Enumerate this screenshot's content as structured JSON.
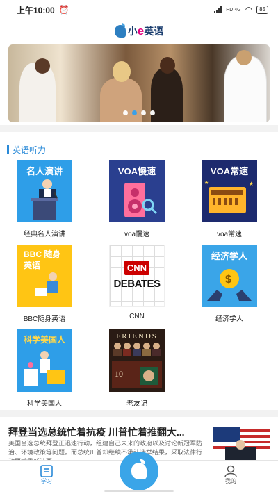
{
  "status_bar": {
    "time": "上午10:00",
    "network_label": "HD 4G",
    "battery": "85"
  },
  "header": {
    "logo_text_prefix": "小",
    "logo_text_e": "e",
    "logo_text_suffix": "英语"
  },
  "banner": {
    "slide_count": 4,
    "active_slide": 1
  },
  "listening": {
    "title": "英语听力",
    "items": [
      {
        "label": "经典名人演讲",
        "cover_text": "名人演讲",
        "bg": "#2e9ee8"
      },
      {
        "label": "voa慢速",
        "cover_text": "VOA慢速",
        "bg": "#2a3f8f"
      },
      {
        "label": "voa常速",
        "cover_text": "VOA常速",
        "bg": "#1d2a6e"
      },
      {
        "label": "BBC随身英语",
        "cover_text": "BBC 随身英语",
        "bg": "#ffc514"
      },
      {
        "label": "CNN",
        "cover_text": "DEBATES",
        "bg": "#ffffff"
      },
      {
        "label": "经济学人",
        "cover_text": "经济学人",
        "bg": "#3aa5e8"
      },
      {
        "label": "科学美国人",
        "cover_text": "科学美国人",
        "bg": "#2e9ee8"
      },
      {
        "label": "老友记",
        "cover_text": "FRIENDS",
        "bg": "#2a1b14"
      }
    ]
  },
  "news": {
    "title": "拜登当选总统忙着抗疫 川普忙着推翻大...",
    "summary": "美国当选总统拜登正迅速行动，组建自己未来的政府以及讨论新冠军防治、环境政策等问题。而总统川普却继续不承认选举结果，采取法律行动要求重新计票。"
  },
  "tabbar": {
    "learn_label": "学习",
    "me_label": "我的"
  },
  "colors": {
    "accent": "#2a8ad8",
    "center_button": "#3aa5e8"
  }
}
